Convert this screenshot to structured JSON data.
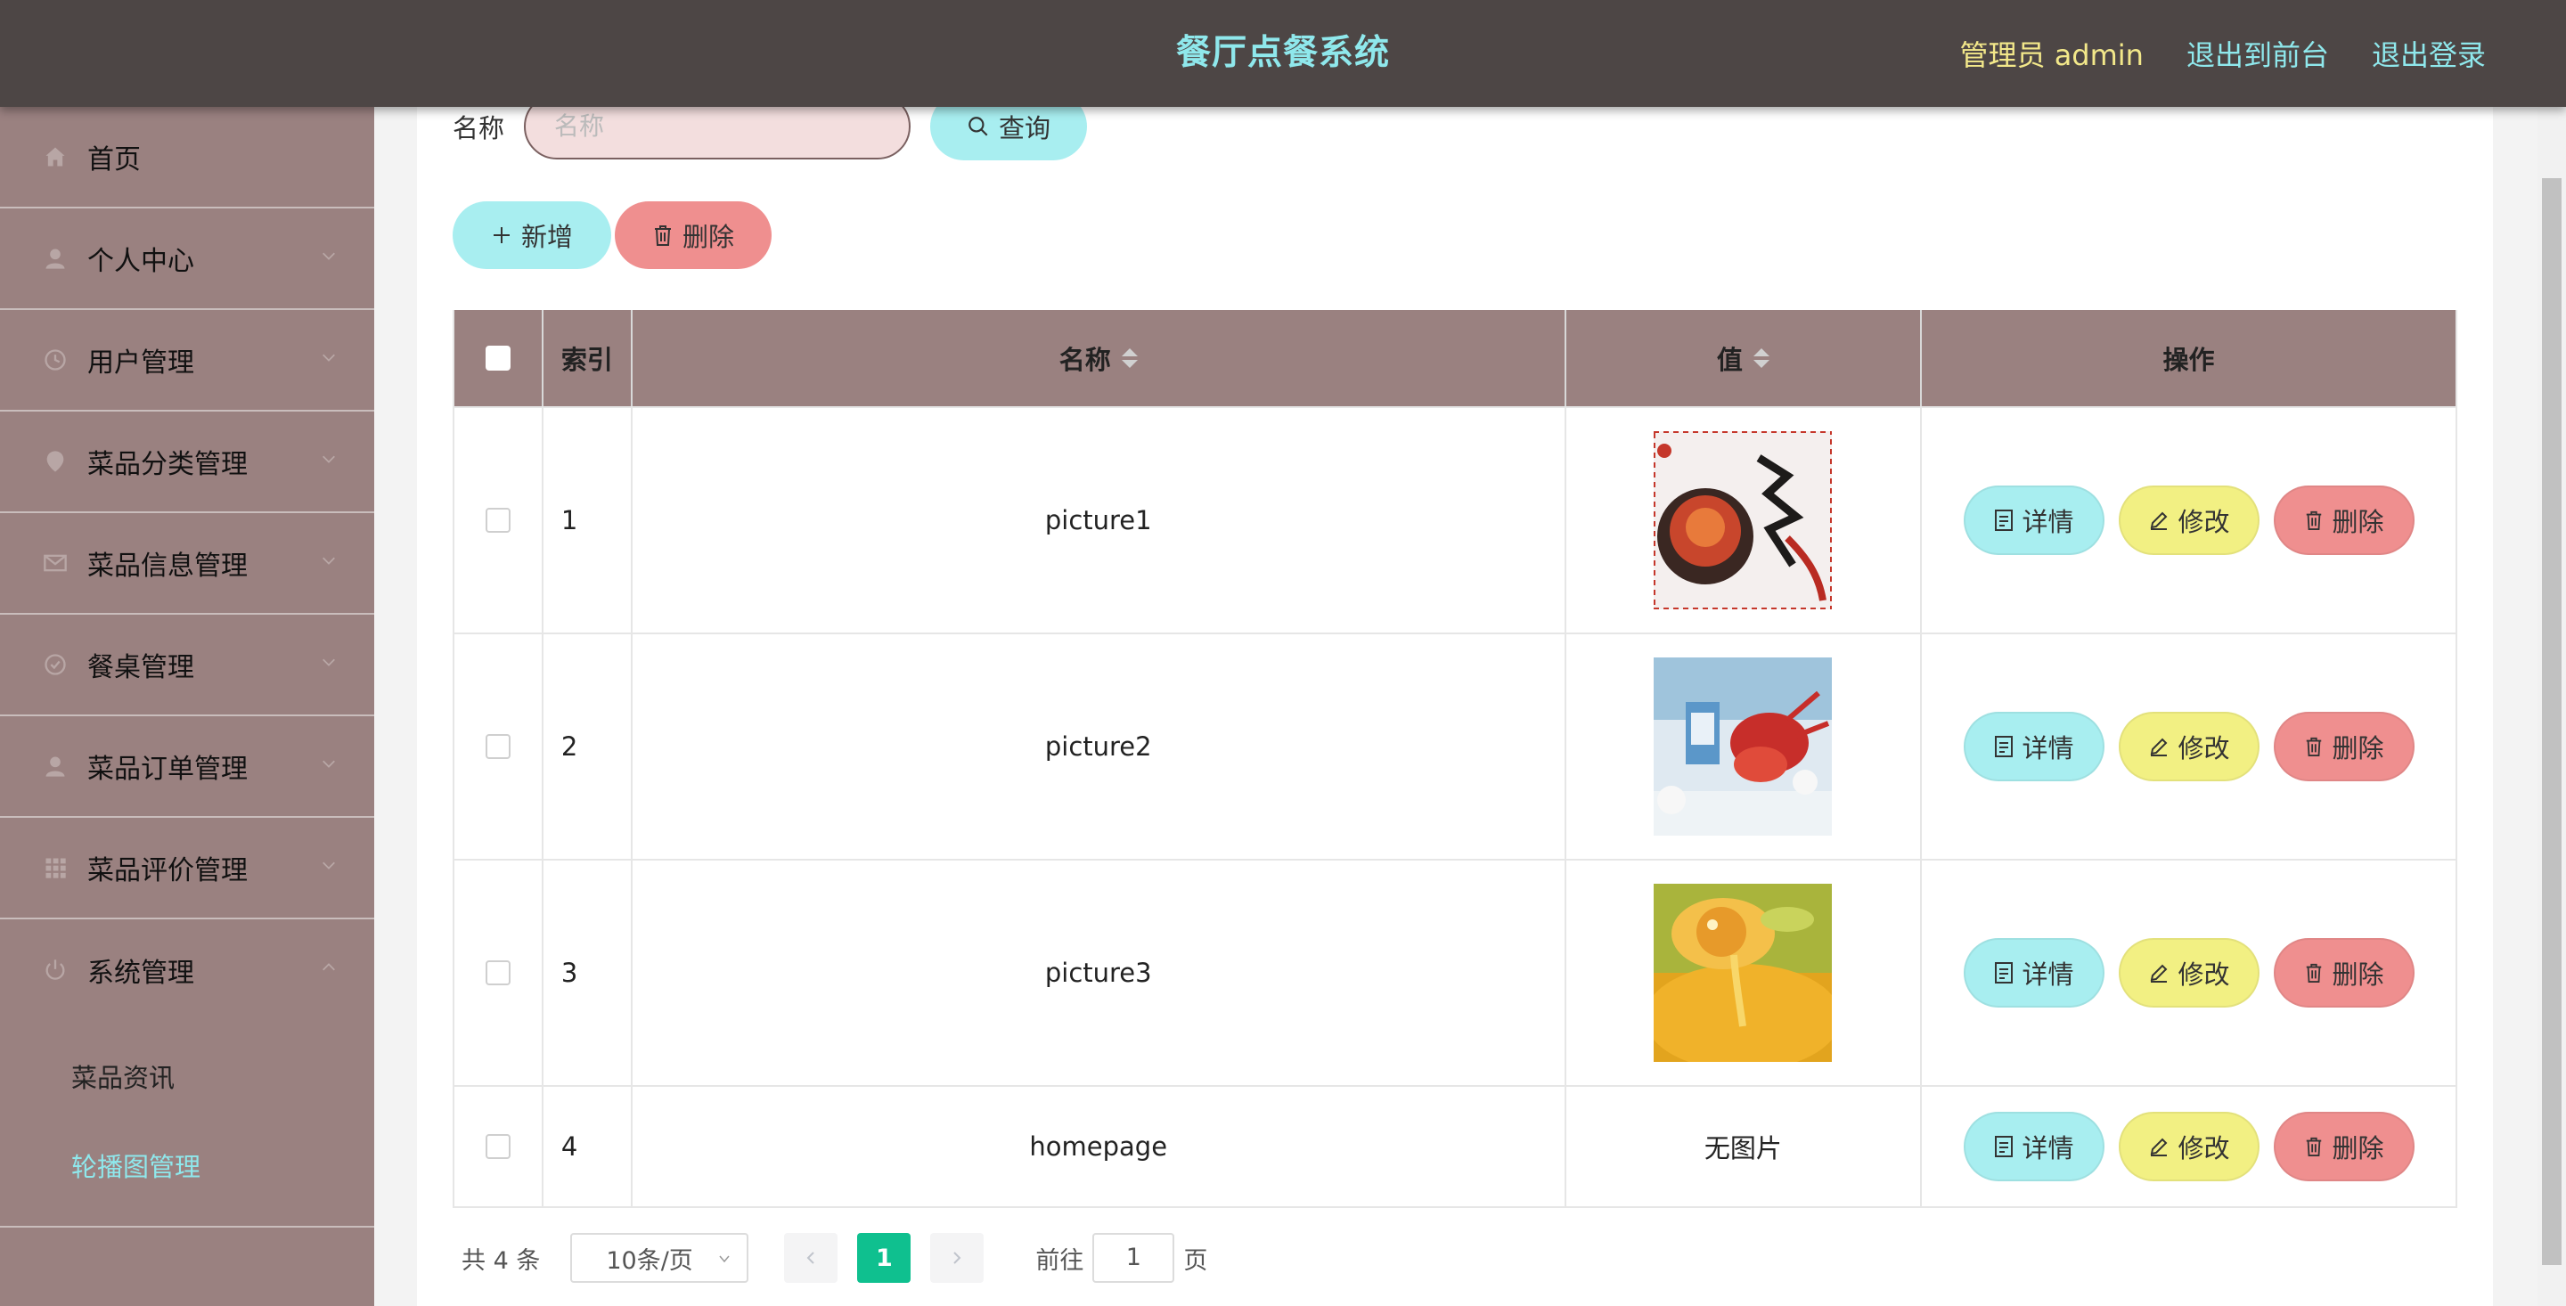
{
  "header": {
    "title": "餐厅点餐系统",
    "admin": "管理员 admin",
    "to_front": "退出到前台",
    "logout": "退出登录"
  },
  "sidebar": {
    "items": [
      {
        "label": "首页",
        "icon": "home-icon"
      },
      {
        "label": "个人中心",
        "icon": "user-icon"
      },
      {
        "label": "用户管理",
        "icon": "clock-icon"
      },
      {
        "label": "菜品分类管理",
        "icon": "location-icon"
      },
      {
        "label": "菜品信息管理",
        "icon": "mail-icon"
      },
      {
        "label": "餐桌管理",
        "icon": "check-circle-icon"
      },
      {
        "label": "菜品订单管理",
        "icon": "user-icon"
      },
      {
        "label": "菜品评价管理",
        "icon": "grid-icon"
      },
      {
        "label": "系统管理",
        "icon": "power-icon"
      }
    ],
    "submenu": [
      "菜品资讯",
      "轮播图管理"
    ],
    "active_sub": "轮播图管理"
  },
  "search": {
    "label": "名称",
    "placeholder": "名称",
    "query_label": "查询"
  },
  "toolbar": {
    "add_label": "新增",
    "delete_label": "删除"
  },
  "table": {
    "columns": [
      "索引",
      "名称",
      "值",
      "操作"
    ],
    "rows": [
      {
        "index": "1",
        "name": "picture1",
        "value": "image",
        "image": "crawfish-bowl"
      },
      {
        "index": "2",
        "name": "picture2",
        "value": "image",
        "image": "crayfish-ice"
      },
      {
        "index": "3",
        "name": "picture3",
        "value": "image",
        "image": "golden-soup"
      },
      {
        "index": "4",
        "name": "homepage",
        "value": "无图片",
        "image": ""
      }
    ],
    "actions": {
      "detail": "详情",
      "edit": "修改",
      "delete": "删除"
    }
  },
  "pagination": {
    "total": "共 4 条",
    "page_size": "10条/页",
    "current_page": "1",
    "goto_label": "前往",
    "goto_value": "1",
    "page_unit": "页"
  },
  "colors": {
    "header_bg": "#4d4645",
    "sidebar_bg": "#9a8180",
    "accent_cyan": "#a8eef0",
    "accent_yellow": "#f2f083",
    "accent_red": "#ef8f8f",
    "page_active": "#0fc08f"
  }
}
